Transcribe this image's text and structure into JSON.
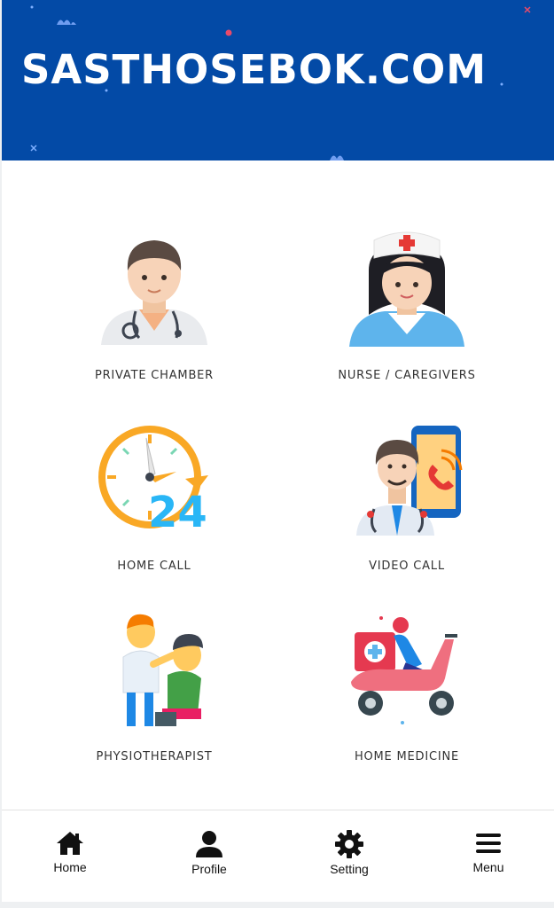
{
  "header": {
    "brand": "SASTHOSEBOK.COM"
  },
  "services": [
    {
      "label": "PRIVATE CHAMBER",
      "icon": "doctor-icon"
    },
    {
      "label": "NURSE / CAREGIVERS",
      "icon": "nurse-icon"
    },
    {
      "label": "HOME CALL",
      "icon": "clock-24-icon"
    },
    {
      "label": "VIDEO CALL",
      "icon": "video-call-doctor-icon"
    },
    {
      "label": "PHYSIOTHERAPIST",
      "icon": "physiotherapy-icon"
    },
    {
      "label": "HOME MEDICINE",
      "icon": "delivery-scooter-icon"
    }
  ],
  "nav": [
    {
      "label": "Home",
      "icon": "home-icon"
    },
    {
      "label": "Profile",
      "icon": "user-icon"
    },
    {
      "label": "Setting",
      "icon": "gear-icon"
    },
    {
      "label": "Menu",
      "icon": "hamburger-icon"
    }
  ],
  "colors": {
    "header_bg": "#034aa6",
    "text": "#333333",
    "page_bg": "#ffffff"
  }
}
